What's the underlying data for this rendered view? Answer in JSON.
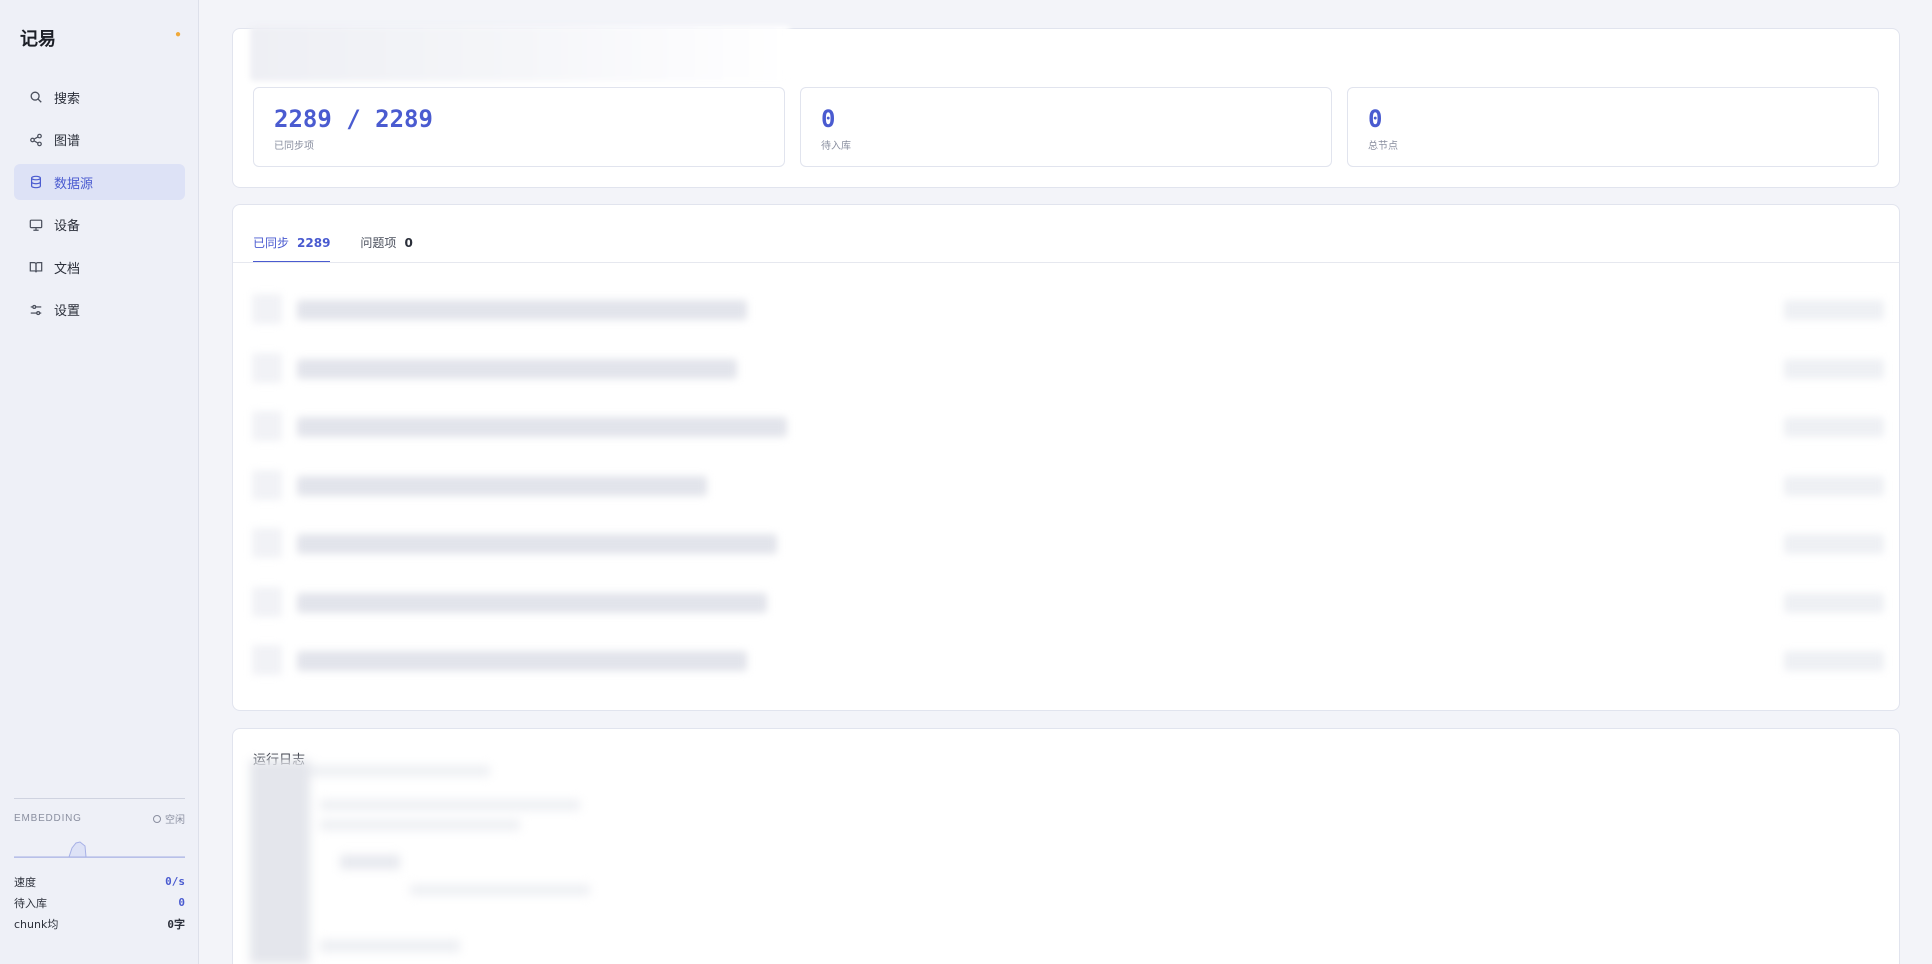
{
  "app": {
    "title": "记易"
  },
  "sidebar": {
    "items": [
      {
        "label": "搜索",
        "icon": "search-icon",
        "active": false
      },
      {
        "label": "图谱",
        "icon": "share-icon",
        "active": false
      },
      {
        "label": "数据源",
        "icon": "database-icon",
        "active": true
      },
      {
        "label": "设备",
        "icon": "monitor-icon",
        "active": false
      },
      {
        "label": "文档",
        "icon": "book-icon",
        "active": false
      },
      {
        "label": "设置",
        "icon": "sliders-icon",
        "active": false
      }
    ],
    "embedding": {
      "title": "EMBEDDING",
      "status": "空闲",
      "metrics": [
        {
          "label": "速度",
          "value": "0/s"
        },
        {
          "label": "待入库",
          "value": "0"
        },
        {
          "label": "chunk均",
          "value": "0字"
        }
      ]
    }
  },
  "stats": [
    {
      "value": "2289 / 2289",
      "label": "已同步项"
    },
    {
      "value": "0",
      "label": "待入库"
    },
    {
      "value": "0",
      "label": "总节点"
    }
  ],
  "tabs": [
    {
      "label": "已同步",
      "count": "2289",
      "active": true
    },
    {
      "label": "问题项",
      "count": "0",
      "active": false
    }
  ],
  "log": {
    "title": "运行日志"
  },
  "colors": {
    "accent": "#4a5bd0",
    "active_bg": "#dde2f6",
    "theme_dot": "#f0a93a"
  }
}
